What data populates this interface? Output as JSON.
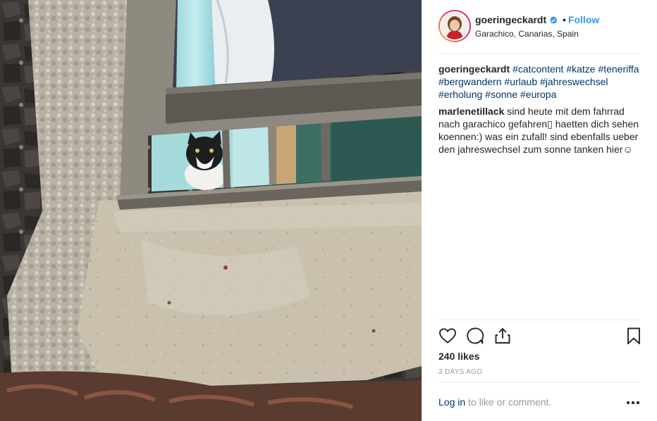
{
  "post": {
    "photo_icon": "cat-in-window-photo",
    "author": {
      "username": "goeringeckardt",
      "verified_icon": "verified-badge-icon",
      "follow_label": "Follow",
      "separator": "•",
      "location": "Garachico, Canarias, Spain"
    },
    "caption": {
      "author": "goeringeckardt",
      "hashtags": [
        "#catcontent",
        "#katze",
        "#teneriffa",
        "#bergwandern",
        "#urlaub",
        "#jahreswechsel",
        "#erholung",
        "#sonne",
        "#europa"
      ]
    },
    "comments": [
      {
        "author": "marlenetillack",
        "text": "sind heute mit dem fahrrad nach garachico gefahren▯ haetten dich sehen koennen:) was ein zufall! sind ebenfalls ueber den jahreswechsel zum sonne tanken hier☺"
      }
    ],
    "actions": {
      "like_icon": "heart-icon",
      "comment_icon": "comment-bubble-icon",
      "share_icon": "share-icon",
      "save_icon": "bookmark-icon"
    },
    "likes_text": "240 likes",
    "timestamp": "3 DAYS AGO",
    "footer": {
      "login_link": "Log in",
      "login_rest": " to like or comment.",
      "more_icon": "more-options-icon"
    },
    "colors": {
      "link": "#3897f0",
      "hashtag": "#003569",
      "muted": "#999999",
      "text": "#262626"
    }
  }
}
